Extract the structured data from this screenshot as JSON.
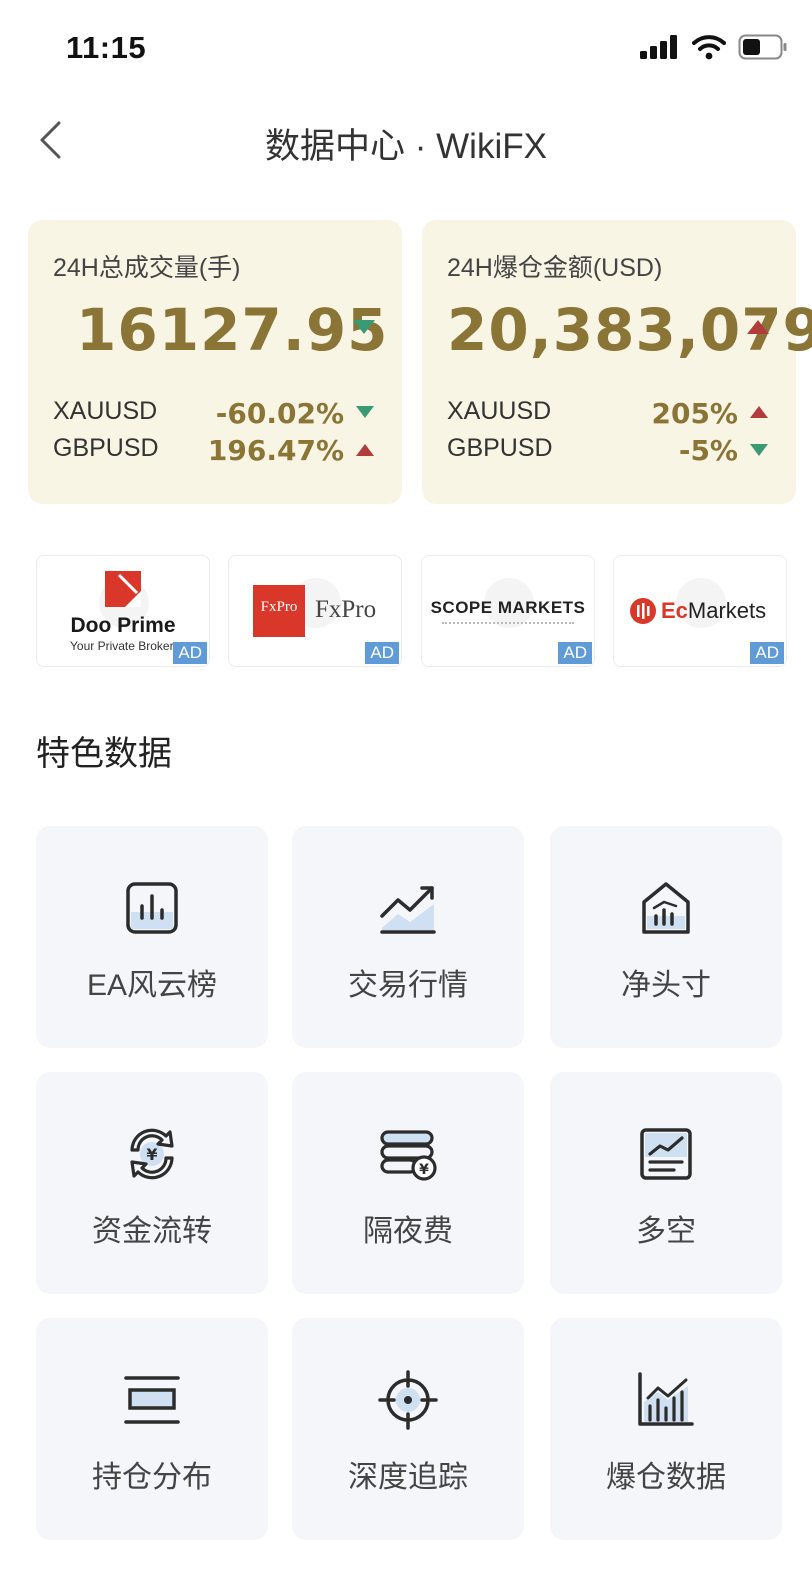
{
  "status_bar": {
    "time": "11:15"
  },
  "nav": {
    "title": "数据中心 · WikiFX"
  },
  "stats": [
    {
      "label": "24H总成交量(手)",
      "value": "16127.95",
      "direction": "down",
      "rows": [
        {
          "symbol": "XAUUSD",
          "change": "-60.02%",
          "direction": "down"
        },
        {
          "symbol": "GBPUSD",
          "change": "196.47%",
          "direction": "up"
        }
      ]
    },
    {
      "label": "24H爆仓金额(USD)",
      "value": "20,383,079",
      "direction": "up",
      "rows": [
        {
          "symbol": "XAUUSD",
          "change": "205%",
          "direction": "up"
        },
        {
          "symbol": "GBPUSD",
          "change": "-5%",
          "direction": "down"
        }
      ]
    }
  ],
  "ads": [
    {
      "name": "Doo Prime",
      "tagline": "Your Private Broker",
      "badge": "AD"
    },
    {
      "name": "FxPro",
      "logo_text": "FxPro",
      "badge": "AD"
    },
    {
      "name": "SCOPE MARKETS",
      "badge": "AD"
    },
    {
      "name": "Ec",
      "name_suffix": "Markets",
      "badge": "AD"
    }
  ],
  "section": {
    "title": "特色数据"
  },
  "features": [
    {
      "label": "EA风云榜",
      "icon": "bar-chart-icon"
    },
    {
      "label": "交易行情",
      "icon": "trend-chart-icon"
    },
    {
      "label": "净头寸",
      "icon": "house-chart-icon"
    },
    {
      "label": "资金流转",
      "icon": "yen-exchange-icon"
    },
    {
      "label": "隔夜费",
      "icon": "coin-stack-icon"
    },
    {
      "label": "多空",
      "icon": "line-chart-board-icon"
    },
    {
      "label": "持仓分布",
      "icon": "position-distribution-icon"
    },
    {
      "label": "深度追踪",
      "icon": "crosshair-icon"
    },
    {
      "label": "爆仓数据",
      "icon": "liquidation-chart-icon"
    }
  ],
  "colors": {
    "card_bg": "#f9f5e5",
    "value_gold": "#8a7436",
    "up_red": "#b23c3c",
    "down_green": "#3a9a73",
    "ad_badge": "#5f9bd6",
    "tile_bg": "#f4f6f9"
  }
}
